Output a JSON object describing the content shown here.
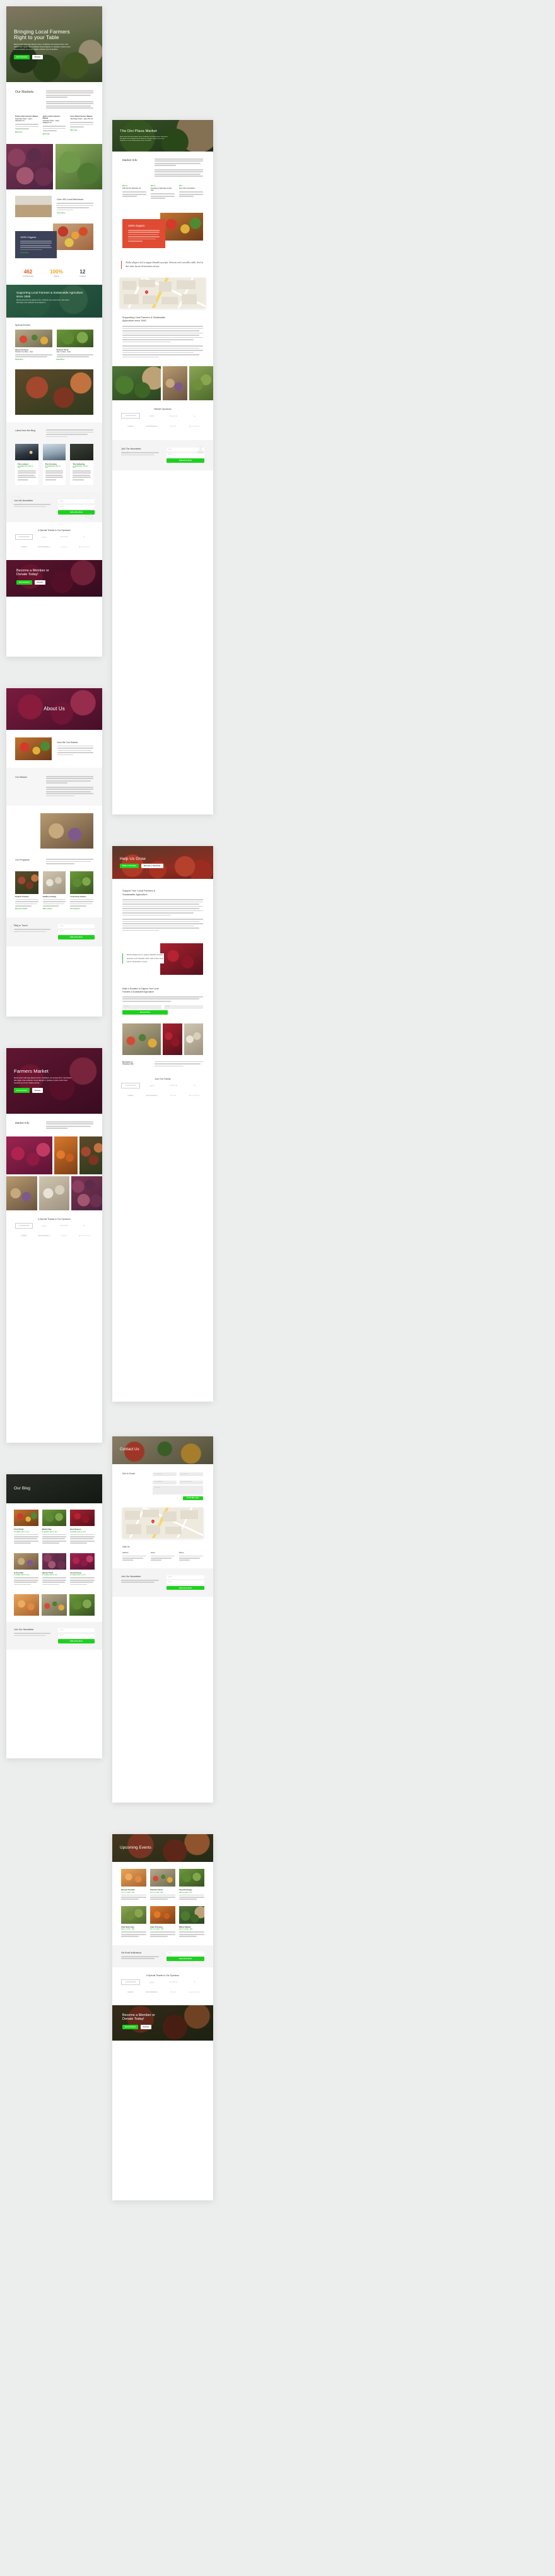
{
  "meta": {
    "background_color": "#eceded",
    "accent_green": "#1fd11f",
    "link_green": "#2bbd2b",
    "accent_red": "#e04b33",
    "accent_navy": "#3c4359",
    "stat_orange": "#e8541f",
    "stat_yellow": "#eda21c"
  },
  "home": {
    "hero": {
      "title_line1": "Bringing Local Farmers",
      "title_line2": "Right to your Table",
      "paragraph": "Mauris porta nulla vitae aliquam luctus. Vestibulum non tempus lorem. Sed ultrices diam ligula, vitae vestibulum lectus aliquam ut. Quisque ut justo a arcu luctus hendrerit nec at nisi. Nullam pulvinar nunc sit faucibus.",
      "btn_primary": "Get Involved",
      "btn_secondary": "Donate"
    },
    "markets": {
      "heading": "Our Markets",
      "intro1": "Lorem ipsum dolor sit amet, consectetur adipiscing elit, sed do eiusmod tempor incididunt ut labore et dolore magna aliqua. Ut enim ad minim veniam, quis nostrud exercitation ullamco laboris nisi ut aliquip ex ea commodo consequat.",
      "intro2": "Duis aute irure dolor in reprehenderit in voluptate velit esse cillum dolore eu fugiat nulla pariatur. Excepteur sint occaecat cupidatat non proident sunt in culpa qui officia deserunt mollit anim. Duis aute irure dolor in reprehenderit in voluptate velit esse cillum dolore.",
      "cards": [
        {
          "title": "Kripton Star Farmers Market",
          "meta": "Saturdays 10am – 2pm | Alameda, CA",
          "body": "Duis aute irure dolor in reprehenderit in voluptate velit esse cillum dolore eu fugiat nulla pariatur.",
          "link": "More Info"
        },
        {
          "title": "Jack London Farmers Market",
          "meta": "Tuesdays 10am – 2pm | Oakland, CA",
          "body": "Duis aute irure dolor in reprehenderit in voluptate velit esse cillum dolore eu fugiat nulla pariatur.",
          "link": "More Info"
        },
        {
          "title": "Ferry Plaza Farmers Market",
          "meta": "Thursdays 10am – 2pm | SF, CA",
          "body": "Duis aute irure dolor in reprehenderit in voluptate velit esse cillum dolore eu fugiat nulla pariatur.",
          "link": "More Info"
        }
      ]
    },
    "merchants": {
      "heading": "Over 400 Local Merchants",
      "body": "Curabitur tortor lorem, lacinia in nunc eget, tristique volutpat urna. Pellentesque suscipit dolor metus, eu cursus sapien molestie non. Sed viverra mauris molestie purus hendrerit.",
      "link": "Learn More"
    },
    "organic": {
      "heading": "100% Organic",
      "body": "Curabitur tortor lorem, lacinia in nunc eget, tristique volutpat urna. Pellentesque suscipit dolor metus, eu cursus sapien molestie non. Sed viverra mauris molestie purus hendrerit. Curabitur tortor lorem, lacinia in nunc eget, tristique volutpat urna.",
      "link": "Learn More"
    },
    "stats": [
      {
        "number": "462",
        "label": "Local Merchants",
        "color": "#e8541f"
      },
      {
        "number": "100%",
        "label": "Organic",
        "color": "#eda21c"
      },
      {
        "number": "12",
        "label": "Locations",
        "color": "#3c4359"
      }
    ],
    "teal_band": {
      "line1": "Supporting Local Farmers & Sustainable Agriculture",
      "line2": "since 1945",
      "sub": "Mauris porta nulla vitae aliquam luctus. Vestibulum non tempus lorem. Sed ultrices diam ligula, vitae vestibulum lectus aliquam ut."
    },
    "events": {
      "heading": "Special Events",
      "cards": [
        {
          "title": "Harvest Festival",
          "meta": "October 12 | 10am – 4pm",
          "link": "Read More"
        },
        {
          "title": "Summer Picnic",
          "meta": "July 4 | 11am – 5pm",
          "link": "Read More"
        }
      ]
    },
    "blog": {
      "heading": "Latest from the Blog",
      "intro": "Lorem ipsum dolor sit amet, consectetur adipiscing elit, sed do eiusmod tempor incididunt ut labore et dolore magna aliqua consectetur.",
      "posts": [
        {
          "title": "The Lookout",
          "meta": "BY ADMIN/ONE | SEP 23, 2017"
        },
        {
          "title": "The Crossing",
          "meta": "BY ADMIN/ONE | SEP 23, 2017"
        },
        {
          "title": "The Gathering",
          "meta": "BY ADMIN/ONE | SEP 23, 2017"
        }
      ]
    },
    "newsletter": {
      "heading": "Join the Newsletter",
      "body": "Lorem ipsum dolor sit amet, consectetur adipiscing elit, sed do eiusmod tempor incididunt ut labore et dolore magna aliqua.",
      "name_placeholder": "Name",
      "email_placeholder": "Email",
      "submit": "Subscribe Now"
    },
    "sponsors": {
      "heading": "A Special Thanks to Our Sponsors",
      "logos": [
        "LOUDHOUSE",
        "wire",
        "INNER",
        "o↑",
        "GRBO",
        "CROSSWELL",
        "Pitch",
        "Red Wave"
      ]
    },
    "cta": {
      "title_line1": "Become a Member or",
      "title_line2": "Donate Today!",
      "btn_primary": "Get Involved",
      "btn_secondary": "Donate"
    }
  },
  "about": {
    "hero_title": "About Us",
    "story": {
      "heading": "How We Got Started",
      "body": "Ut enim ad minim veniam, quis nostrud exercitation ullamco laboris nisi ut aliquip ex ea commodo consequat. Duis aute irure dolor in reprehenderit in voluptate velit esse cillum dolore eu fugiat nulla pariatur."
    },
    "mission": {
      "heading": "Our Mission",
      "body1": "Ut enim ad minim veniam, quis nostrud exercitation ullamco laboris nisi ut aliquip ex ea commodo consequat. Duis aute irure dolor in reprehenderit in voluptate velit esse cillum dolore eu fugiat nulla pariatur excepteur sint occaecat qui officia deserunt.",
      "body2": "Sed ut perspiciatis unde omnis iste natus error sit voluptatem accusantium doloremque laudantium, totam rem aperiam eaque ipsa quae ab illo inventore veritatis et quasi architecto beatae vitae dicta sunt explicabo nemo enim."
    },
    "programs": {
      "heading": "Our Programs",
      "intro": "Sed ut perspiciatis unde omnis iste natus error sit voluptatem accusantium doloremque laudantium totam rem aperiam eaque ipsa quae ab illo inventore veritatis.",
      "cards": [
        {
          "title": "Organic Produce",
          "body": "Irure et voluptatem accusantium doloremque laudantium, totam rem aperiam. Sed ut perspiciatis unde omnis iste natus error sit voluptatem.",
          "link": "Become a Seller"
        },
        {
          "title": "Healthy Cooking",
          "body": "Irure et voluptatem accusantium doloremque laudantium, totam rem aperiam. Sed ut perspiciatis unde omnis iste natus error sit voluptatem.",
          "link": "Take a Class"
        },
        {
          "title": "Community Garden",
          "body": "Irure et voluptatem accusantium doloremque laudantium, totam rem aperiam. Sed ut perspiciatis unde omnis iste natus error sit voluptatem.",
          "link": "Get Involved"
        }
      ]
    },
    "contact": {
      "heading": "Stay In Touch",
      "name_placeholder": "Name",
      "email_placeholder": "Email",
      "submit": "Subscribe Now"
    }
  },
  "farmers_market": {
    "hero": {
      "title": "Farmers Market",
      "paragraph": "Mauris porta nulla vitae aliquam luctus. Vestibulum non tempus lorem. Sed ultrices diam ligula, vitae vestibulum lectus aliquam ut. Quisque ut justo a arcu luctus hendrerit nec at nisi. Nullam pulvinar.",
      "btn_primary": "Get Involved",
      "btn_secondary": "Donate"
    },
    "market_info": {
      "heading": "Market Info",
      "intro": "Lorem ipsum dolor sit amet, consectetur adipiscing elit, sed do eiusmod tempor incididunt ut labore et dolore magna aliqua. Ut enim ad minim veniam, quis nostrud exercitation."
    },
    "sponsors_heading": "A Special Thanks to Our Sponsors"
  },
  "blog_page": {
    "hero_title": "Our Blog",
    "posts": [
      {
        "title": "Fresh Picks",
        "meta": "BY ADMIN | SEP 23, 2017"
      },
      {
        "title": "Market Day",
        "meta": "BY ADMIN | SEP 23, 2017"
      },
      {
        "title": "Root Season",
        "meta": "BY ADMIN | SEP 23, 2017"
      },
      {
        "title": "In the Field",
        "meta": "BY ADMIN | SEP 23, 2017"
      },
      {
        "title": "Harvest Time",
        "meta": "BY ADMIN | SEP 23, 2017"
      },
      {
        "title": "Good Greens",
        "meta": "BY ADMIN | SEP 23, 2017"
      }
    ],
    "newsletter_heading": "Join Our Newsletter"
  },
  "divi_plaza": {
    "hero": {
      "title": "The Divi Plaza Market",
      "paragraph": "Mauris porta nulla vitae aliquam luctus. Vestibulum non tempus lorem. Sed ultrices diam ligula, vitae vestibulum lectus aliquam ut. Quisque ut justo a arcu luctus hendrerit nec at nisi. Nullam pulvinar nunc sit faucibus."
    },
    "market_info": {
      "heading": "Market Info",
      "intro1": "Lorem ipsum dolor sit amet, consectetur adipiscing elit, sed do eiusmod tempor incididunt ut labore et dolore magna aliqua. Ut enim ad minim veniam, quis nostrud exercitation ullamco laboris nisi ut aliquip ex ea commodo consequat.",
      "intro2": "Duis aute irure dolor in reprehenderit in voluptate velit esse cillum dolore eu fugiat nulla pariatur. Excepteur sint occaecat cupidatat non proident sunt in culpa qui officia deserunt mollit anim. Duis aute irure dolor in reprehenderit in voluptate velit esse cillum dolore.",
      "columns": [
        {
          "eyebrow": "Where",
          "title": "1021 Divi St. Alameda, CA",
          "body": "Duis aute irure dolor in reprehenderit in voluptate velit esse cillum dolore eu fugiat nulla pariatur."
        },
        {
          "eyebrow": "When",
          "title": "Tuesdays & Saturdays 8-4am – 4pm",
          "body": "Duis aute irure dolor in reprehenderit in voluptate velit esse cillum dolore eu fugiat nulla pariatur."
        },
        {
          "eyebrow": "Who",
          "title": "Over 150 Local Sellers",
          "body": "Duis aute irure dolor in reprehenderit in voluptate velit esse cillum dolore eu fugiat nulla pariatur."
        }
      ]
    },
    "organic": {
      "heading": "100% Organic",
      "body": "Curabitur tortor lorem, lacinia in nunc eget, tristique volutpat urna. Pellentesque suscipit dolor metus, eu cursus sapien molestie non. Sed viverra mauris molestie purus hendrerit. Curabitur tortor lorem, lacinia in nunc eget, tristique volutpat urna."
    },
    "quote": "Nulla aliquet nisl a augue blandit suscipit. Aenean sed convallis nibh. Sed ut dui vitae lacus elementum cursus.",
    "support": {
      "heading_line1": "Supporting Local Farmers & Sustainable",
      "heading_line2": "Agriculture since 1945",
      "body1": "Ut enim ad minim veniam, quis nostrud exercitation ullamco laboris nisi ut aliquip ex ea commodo consequat. Duis aute irure dolor in reprehenderit in voluptate velit esse cillum dolore eu fugiat nulla pariatur. Excepteur sint occaecat cupidatat non proident sunt in culpa qui officia deserunt mollit anim id est laborum. Sed ut perspiciatis unde omnis iste natus error sit voluptatem accusantium doloremque laudantium totam rem aperiam eaque ipsa quae ab illo inventore veritatis.",
      "body2": "Lorem ipsum dolor sit amet, consectetur adipiscing elit. Nunc vel augue blandit ante pharetra varius ut tempus ligula. Mauris consectetur sollicitudin est, vitae varius libero aliquam vitae mattis justo, ut ultrices felis. Donec iaculis sem at justo viverra, quis auctor mi iaculis."
    },
    "sponsors_heading": "Market Sponsors",
    "newsletter_heading": "Join The Newsletter"
  },
  "help_us_grow": {
    "hero": {
      "title": "Help Us Grow",
      "btn_primary": "Make a Donation",
      "btn_secondary": "Become a Volunteer"
    },
    "support": {
      "heading_line1": "Support Your Local Farmers &",
      "heading_line2": "Sustainable Agriculture",
      "body1": "Ut enim ad minim veniam, quis nostrud exercitation ullamco laboris nisi ut aliquip ex ea commodo consequat. Duis aute irure dolor in reprehenderit in voluptate velit esse cillum dolore eu fugiat nulla pariatur. Excepteur sint occaecat cupidatat non proident sunt in culpa qui officia deserunt mollit anim id est laborum. Sed ut perspiciatis unde omnis iste natus error sit voluptatem.",
      "body2": "Lorem ipsum dolor sit amet, consectetur adipiscing elit. Nunc vel augue blandit ante pharetra varius ut tempus ligula. Mauris consectetur sollicitudin est, vitae varius libero aliquam vitae mattis justo, ut ultrices felis."
    },
    "quote": "Nulla aliquet nisl a augue blandit suscipit. Aenean sed convallis nibh. Sed ut dui vitae lacus elementum cursus.",
    "donate": {
      "heading_line1": "Make a Donation to Support Your Local",
      "heading_line2": "Farmers & Sustainable Agriculture",
      "amount_placeholder": "Amount",
      "submit": "Donate Now"
    },
    "sponsors_heading": "Join Our Family"
  },
  "contact_page": {
    "hero_title": "Contact Us",
    "form": {
      "heading": "Get In Touch",
      "first_name": "First Name",
      "last_name": "Last Name",
      "email": "Email Address",
      "interest": "I am interested in",
      "message": "Message",
      "submit": "Send Message"
    },
    "visit": {
      "heading": "Visit Us",
      "columns": [
        {
          "title": "Address",
          "body": "1021 Divi St. Alameda, CA 94501"
        },
        {
          "title": "Hours",
          "body": "Tuesdays & Saturdays 8am – 4pm"
        },
        {
          "title": "Phone",
          "body": "(255) 352-6258"
        }
      ]
    },
    "newsletter_heading": "Join Our Newsletter"
  },
  "events_page": {
    "hero_title": "Upcoming Events",
    "events": [
      {
        "title": "Harvest Festival",
        "meta": "OCT 12 | 10AM – 4PM"
      },
      {
        "title": "Summer Picnic",
        "meta": "JUL 04 | 11AM – 5PM"
      },
      {
        "title": "Seed Exchange",
        "meta": "MAR 18 | 9AM – 1PM"
      },
      {
        "title": "Chef Demo Day",
        "meta": "MAY 22 | 12PM – 3PM"
      },
      {
        "title": "Cider Pressing",
        "meta": "NOV 02 | 10AM – 2PM"
      },
      {
        "title": "Winter Market",
        "meta": "DEC 15 | 10AM – 4PM"
      }
    ],
    "notify": {
      "heading": "Get Email Notifications",
      "email_placeholder": "Email",
      "submit": "Subscribe Now"
    },
    "sponsors_heading": "A Special Thanks to Our Sponsors",
    "cta": {
      "title_line1": "Become a Member or",
      "title_line2": "Donate Today!",
      "btn_primary": "Get Involved",
      "btn_secondary": "Donate"
    }
  }
}
